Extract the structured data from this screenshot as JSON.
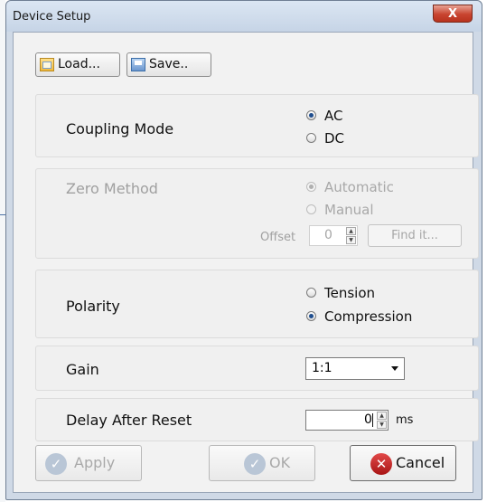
{
  "window": {
    "title": "Device Setup",
    "close_glyph": "X"
  },
  "toolbar": {
    "load_label": "Load...",
    "load_icon": "folder-open-icon",
    "save_label": "Save..",
    "save_icon": "floppy-disk-icon"
  },
  "coupling": {
    "label": "Coupling Mode",
    "options": [
      {
        "label": "AC",
        "selected": true
      },
      {
        "label": "DC",
        "selected": false
      }
    ]
  },
  "zero": {
    "label": "Zero Method",
    "enabled": false,
    "options": [
      {
        "label": "Automatic",
        "selected": true
      },
      {
        "label": "Manual",
        "selected": false
      }
    ],
    "offset_label": "Offset",
    "offset_value": "0",
    "find_label": "Find it..."
  },
  "polarity": {
    "label": "Polarity",
    "options": [
      {
        "label": "Tension",
        "selected": false
      },
      {
        "label": "Compression",
        "selected": true
      }
    ]
  },
  "gain": {
    "label": "Gain",
    "selected": "1:1"
  },
  "delay": {
    "label": "Delay After Reset",
    "value": "0",
    "unit": "ms"
  },
  "buttons": {
    "apply": "Apply",
    "ok": "OK",
    "cancel": "Cancel"
  }
}
